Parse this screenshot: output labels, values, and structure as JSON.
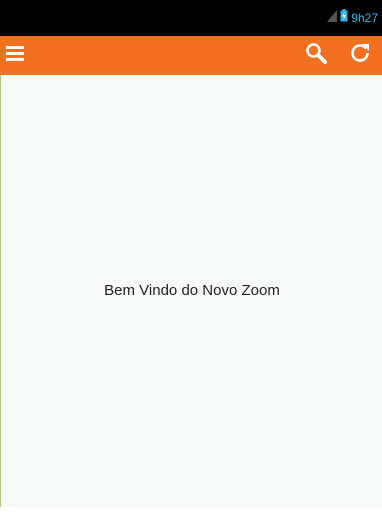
{
  "status_bar": {
    "time": "9h27",
    "icons": [
      "signal-icon",
      "battery-icon"
    ],
    "time_color": "#33b5e5"
  },
  "toolbar": {
    "background": "#f37021",
    "icons": [
      "menu-icon",
      "search-icon",
      "refresh-icon"
    ]
  },
  "content": {
    "welcome_text": "Bem Vindo do Novo Zoom"
  }
}
